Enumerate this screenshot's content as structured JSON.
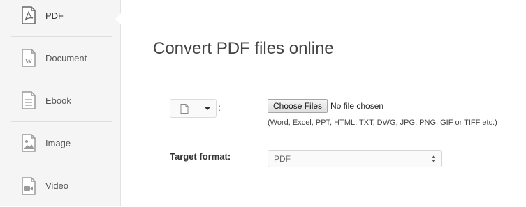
{
  "sidebar": {
    "items": [
      {
        "label": "PDF",
        "icon": "pdf-icon",
        "active": true
      },
      {
        "label": "Document",
        "icon": "word-document-icon",
        "active": false
      },
      {
        "label": "Ebook",
        "icon": "ebook-icon",
        "active": false
      },
      {
        "label": "Image",
        "icon": "image-icon",
        "active": false
      },
      {
        "label": "Video",
        "icon": "video-icon",
        "active": false
      }
    ]
  },
  "main": {
    "title": "Convert PDF files online",
    "upload": {
      "colon": ":",
      "choose_button": "Choose Files",
      "no_file_text": "No file chosen",
      "formats_hint": "(Word, Excel, PPT, HTML, TXT, DWG, JPG, PNG, GIF or TIFF etc.)"
    },
    "target": {
      "label": "Target format:",
      "selected": "PDF"
    }
  },
  "colors": {
    "sidebar_bg": "#f5f5f5",
    "icon_gray": "#9a9a9a",
    "text_dark": "#333333"
  }
}
